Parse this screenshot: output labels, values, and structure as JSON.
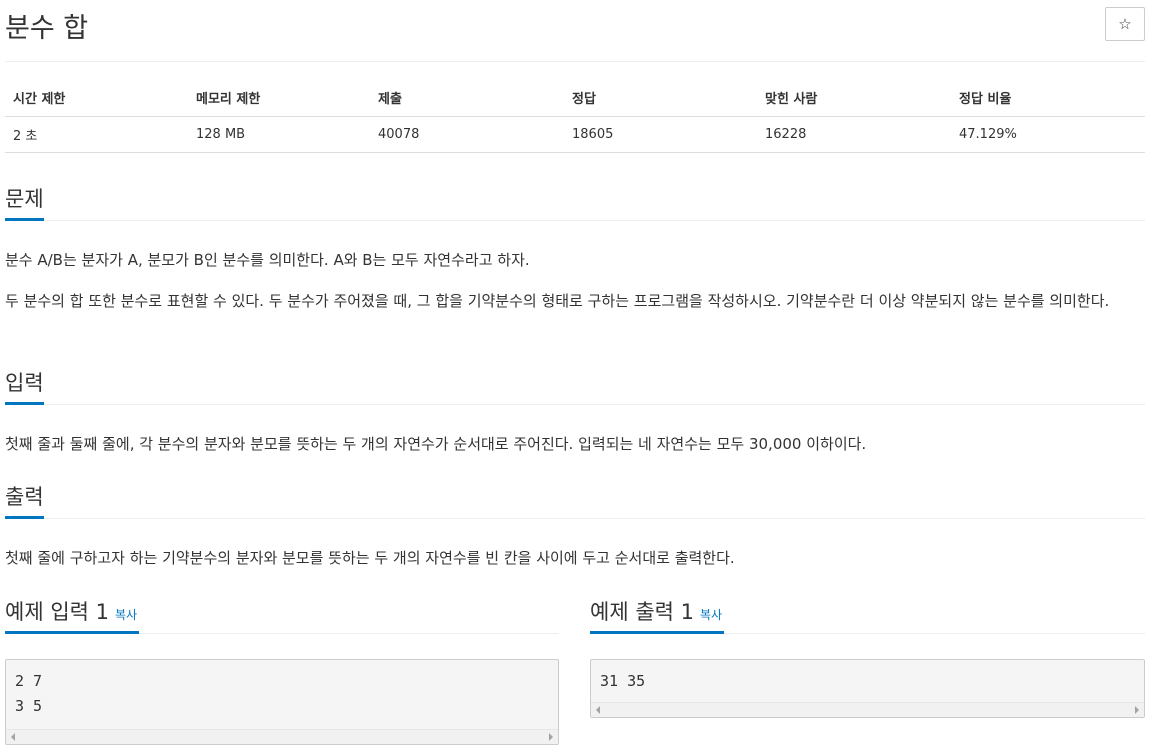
{
  "problem": {
    "title": "분수 합",
    "star_icon": "☆"
  },
  "info_table": {
    "headers": [
      "시간 제한",
      "메모리 제한",
      "제출",
      "정답",
      "맞힌 사람",
      "정답 비율"
    ],
    "values": [
      "2 초",
      "128 MB",
      "40078",
      "18605",
      "16228",
      "47.129%"
    ]
  },
  "sections": {
    "description": {
      "heading": "문제",
      "p1": "분수 A/B는 분자가 A, 분모가 B인 분수를 의미한다. A와 B는 모두 자연수라고 하자.",
      "p2": "두 분수의 합 또한 분수로 표현할 수 있다. 두 분수가 주어졌을 때, 그 합을 기약분수의 형태로 구하는 프로그램을 작성하시오. 기약분수란 더 이상 약분되지 않는 분수를 의미한다."
    },
    "input": {
      "heading": "입력",
      "p1": "첫째 줄과 둘째 줄에, 각 분수의 분자와 분모를 뜻하는 두 개의 자연수가 순서대로 주어진다. 입력되는 네 자연수는 모두 30,000 이하이다."
    },
    "output": {
      "heading": "출력",
      "p1": "첫째 줄에 구하고자 하는 기약분수의 분자와 분모를 뜻하는 두 개의 자연수를 빈 칸을 사이에 두고 순서대로 출력한다."
    }
  },
  "samples": {
    "input": {
      "heading": "예제 입력 1",
      "copy": "복사",
      "lines": [
        "2 7",
        "3 5"
      ]
    },
    "output": {
      "heading": "예제 출력 1",
      "copy": "복사",
      "lines": [
        "31 35"
      ]
    }
  }
}
